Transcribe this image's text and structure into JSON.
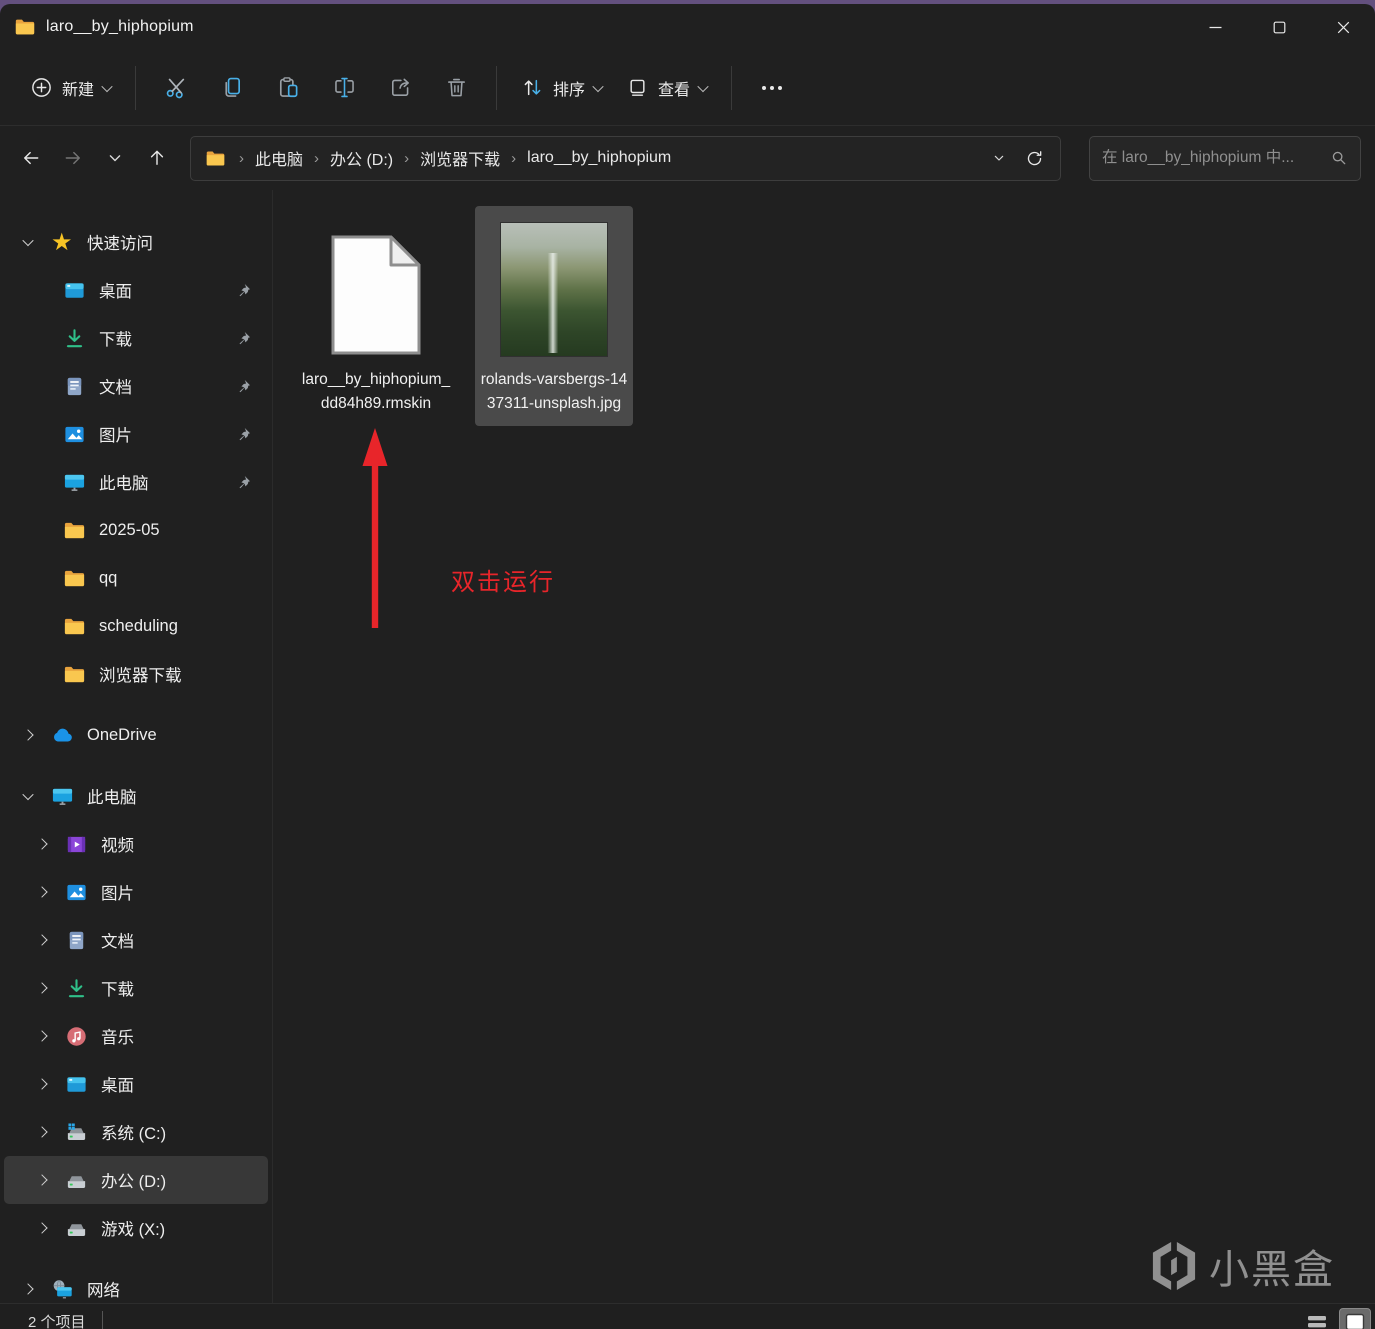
{
  "window": {
    "title": "laro__by_hiphopium"
  },
  "toolbar": {
    "new_label": "新建",
    "sort_label": "排序",
    "view_label": "查看"
  },
  "navbar": {
    "breadcrumbs": [
      "此电脑",
      "办公 (D:)",
      "浏览器下载",
      "laro__by_hiphopium"
    ],
    "crumb_separator": "›",
    "search_placeholder": "在 laro__by_hiphopium 中..."
  },
  "sidebar": {
    "quick_access": {
      "label": "快速访问",
      "items": [
        {
          "label": "桌面",
          "pinned": true
        },
        {
          "label": "下载",
          "pinned": true
        },
        {
          "label": "文档",
          "pinned": true
        },
        {
          "label": "图片",
          "pinned": true
        },
        {
          "label": "此电脑",
          "pinned": true
        },
        {
          "label": "2025-05",
          "pinned": false
        },
        {
          "label": "qq",
          "pinned": false
        },
        {
          "label": "scheduling",
          "pinned": false
        },
        {
          "label": "浏览器下载",
          "pinned": false
        }
      ]
    },
    "onedrive_label": "OneDrive",
    "this_pc": {
      "label": "此电脑",
      "items": [
        {
          "label": "视频"
        },
        {
          "label": "图片"
        },
        {
          "label": "文档"
        },
        {
          "label": "下载"
        },
        {
          "label": "音乐"
        },
        {
          "label": "桌面"
        },
        {
          "label": "系统 (C:)"
        },
        {
          "label": "办公 (D:)",
          "selected": true
        },
        {
          "label": "游戏 (X:)"
        }
      ]
    },
    "network_label": "网络"
  },
  "files": [
    {
      "name": "laro__by_hiphopium_dd84h89.rmskin",
      "type": "rmskin"
    },
    {
      "name": "rolands-varsbergs-1437311-unsplash.jpg",
      "type": "jpg",
      "selected": true
    }
  ],
  "annotation": {
    "text": "双击运行"
  },
  "statusbar": {
    "items_count": "2 个项目"
  },
  "watermark": {
    "text": "小黑盒"
  },
  "colors": {
    "accent_blue": "#49b0e8",
    "folder_yellow": "#f9c74f",
    "annotation_red": "#e8252a",
    "top_strip_purple": "#63507e",
    "selection_gray": "#4a4a4a"
  }
}
